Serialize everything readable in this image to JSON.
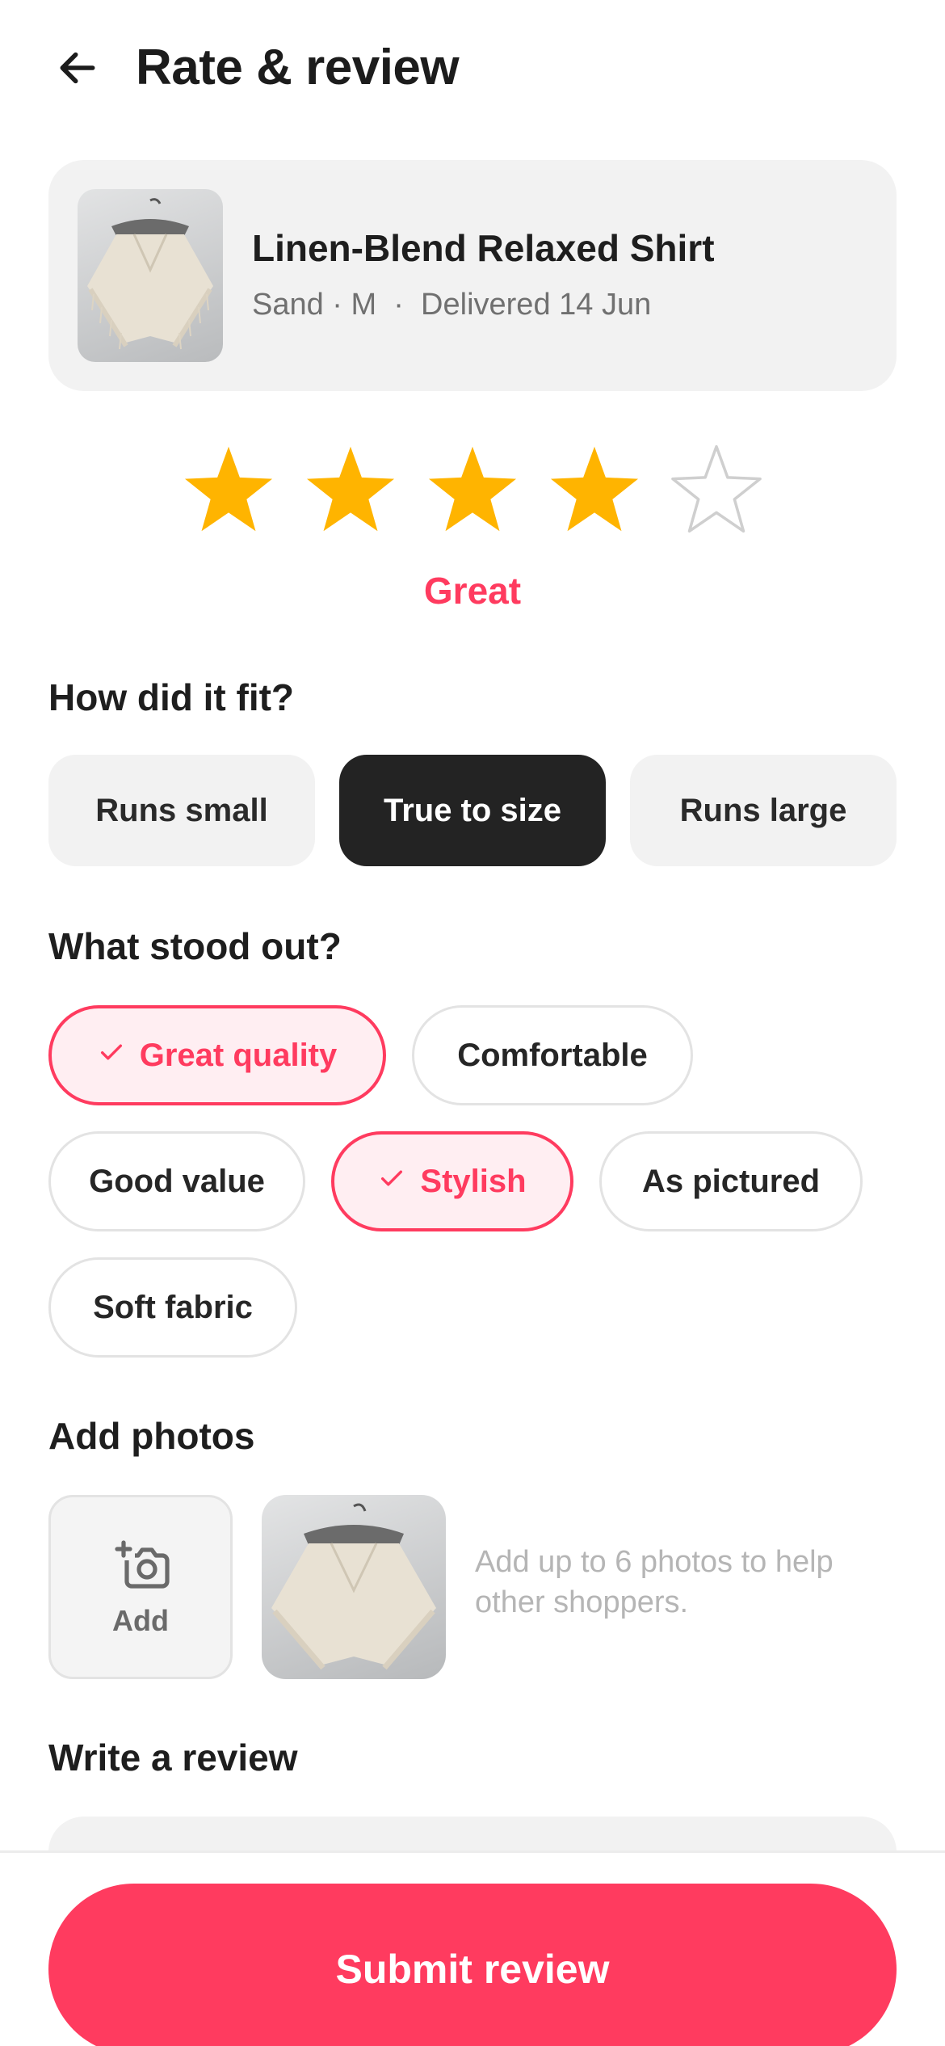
{
  "header": {
    "back_icon": "arrow-left-icon",
    "title": "Rate & review"
  },
  "product": {
    "name": "Linen-Blend Relaxed Shirt",
    "meta": "Sand · M  ·  Delivered 14 Jun",
    "image_icon": "product-photo"
  },
  "rating": {
    "value": 4,
    "max": 5,
    "label": "Great",
    "filled_color": "#FFB400",
    "empty_color": "#CFCFCF"
  },
  "fit": {
    "title": "How did it fit?",
    "options": [
      {
        "label": "Runs small",
        "selected": false
      },
      {
        "label": "True to size",
        "selected": true
      },
      {
        "label": "Runs large",
        "selected": false
      }
    ]
  },
  "highlights": {
    "title": "What stood out?",
    "tags": [
      {
        "label": "Great quality",
        "selected": true
      },
      {
        "label": "Comfortable",
        "selected": false
      },
      {
        "label": "Good value",
        "selected": false
      },
      {
        "label": "Stylish",
        "selected": true
      },
      {
        "label": "As pictured",
        "selected": false
      },
      {
        "label": "Soft fabric",
        "selected": false
      }
    ]
  },
  "photos": {
    "title": "Add photos",
    "add_label": "Add",
    "add_icon": "camera-add-icon",
    "hint": "Add up to 6 photos to help other shoppers."
  },
  "review": {
    "title": "Write a review"
  },
  "footer": {
    "submit_label": "Submit review"
  },
  "colors": {
    "accent": "#FF3B5F",
    "accent_light": "#FFEEF2",
    "dark_selected": "#232323",
    "surface": "#F2F2F2"
  }
}
